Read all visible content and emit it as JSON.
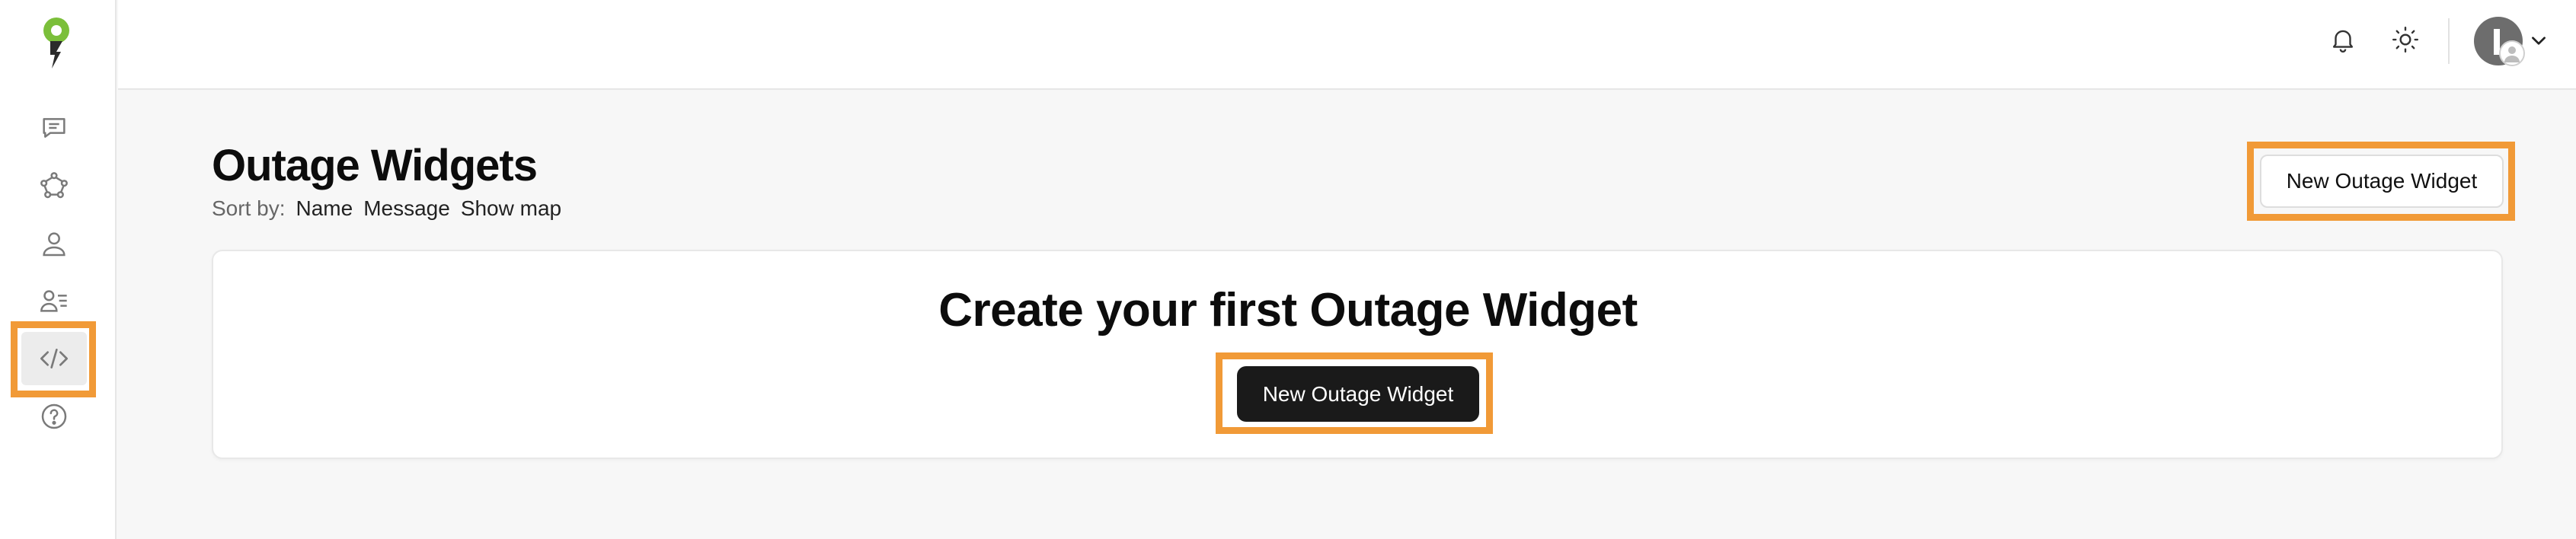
{
  "app": {
    "title": "Outage Widgets"
  },
  "sidebar": {
    "items": [
      {
        "icon": "chat-bubble-icon",
        "label": "Messages"
      },
      {
        "icon": "network-icon",
        "label": "Integrations"
      },
      {
        "icon": "user-icon",
        "label": "Customers"
      },
      {
        "icon": "user-list-icon",
        "label": "Team"
      },
      {
        "icon": "code-icon",
        "label": "Widgets",
        "active": true
      },
      {
        "icon": "help-circle-icon",
        "label": "Help"
      }
    ]
  },
  "header": {
    "icons": [
      "bell-icon",
      "sun-icon",
      "avatar",
      "chevron-down-icon"
    ]
  },
  "main": {
    "title": "Outage Widgets",
    "sort_label": "Sort by:",
    "sort_options": [
      "Name",
      "Message",
      "Show map"
    ],
    "new_button_label": "New Outage Widget",
    "empty_state": {
      "title": "Create your first Outage Widget",
      "button_label": "New Outage Widget"
    }
  },
  "colors": {
    "accent_highlight": "#f19a37",
    "logo_green": "#7bbf3a",
    "dark_button": "#1a1a1a"
  }
}
